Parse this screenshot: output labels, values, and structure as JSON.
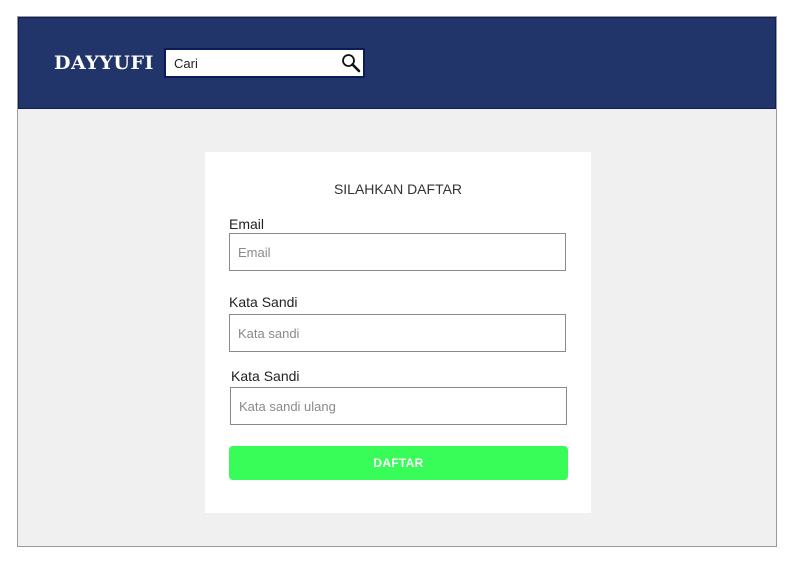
{
  "header": {
    "logo": "DAYYUFI",
    "search": {
      "value": "Cari",
      "icon": "search-icon"
    },
    "background_color": "#22356a"
  },
  "form": {
    "title": "SILAHKAN DAFTAR",
    "email": {
      "label": "Email",
      "placeholder": "Email"
    },
    "password": {
      "label": "Kata Sandi",
      "placeholder": "Kata sandi"
    },
    "confirm_password": {
      "label": "Kata Sandi",
      "placeholder": "Kata sandi ulang"
    },
    "submit_label": "DAFTAR",
    "submit_color": "#38fc58"
  }
}
